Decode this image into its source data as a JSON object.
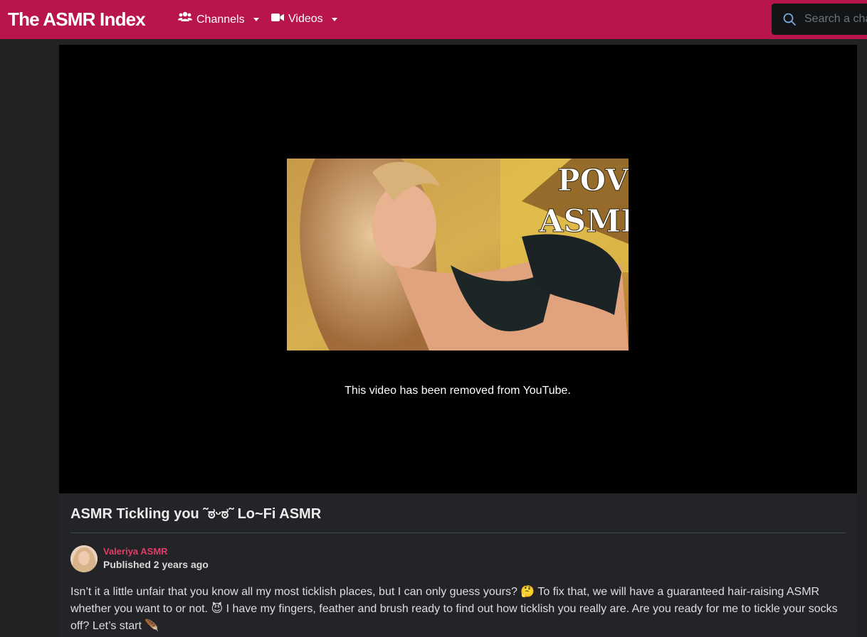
{
  "nav": {
    "brand": "The ASMR Index",
    "channels_label": "Channels",
    "videos_label": "Videos",
    "search_placeholder": "Search a channel",
    "accent_color": "#b8154a"
  },
  "video": {
    "thumbnail_overlay_line1": "POV",
    "thumbnail_overlay_line2": "ASMR",
    "removed_message": "This video has been removed from YouTube."
  },
  "info": {
    "title": "ASMR Tickling you ˜ಠᵕಠ˜ Lo~Fi ASMR",
    "channel_name": "Valeriya ASMR",
    "published": "Published 2 years ago",
    "description": "Isn’t it a little unfair that you know all my most ticklish places, but I can only guess yours? 🤔 To fix that, we will have a guaranteed hair-raising ASMR whether you want to or not. 😈 I have my fingers, feather and brush ready to find out how ticklish you really are. Are you ready for me to tickle your socks off? Let’s start 🪶"
  }
}
